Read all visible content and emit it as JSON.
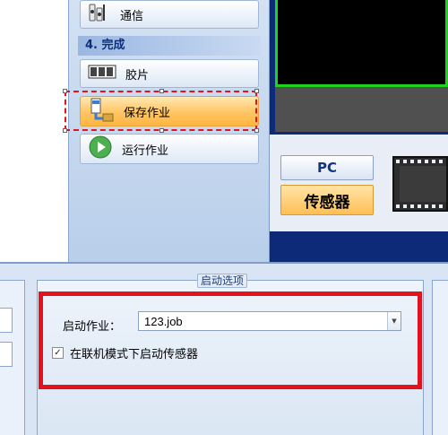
{
  "nav": {
    "communication_label": "通信",
    "finish_section_title": "4. 完成",
    "filmstrip_label": "胶片",
    "save_job_label": "保存作业",
    "run_job_label": "运行作业"
  },
  "mode": {
    "pc_label": "PC",
    "sensor_label": "传感器"
  },
  "startup": {
    "group_title": "启动选项",
    "job_label": "启动作业：",
    "job_value": "123.job",
    "online_label": "在联机模式下启动传感器",
    "online_checked": true
  },
  "colors": {
    "highlight_red": "#e3121c",
    "video_border_green": "#1ed21e",
    "active_orange": "#ffbf55"
  }
}
